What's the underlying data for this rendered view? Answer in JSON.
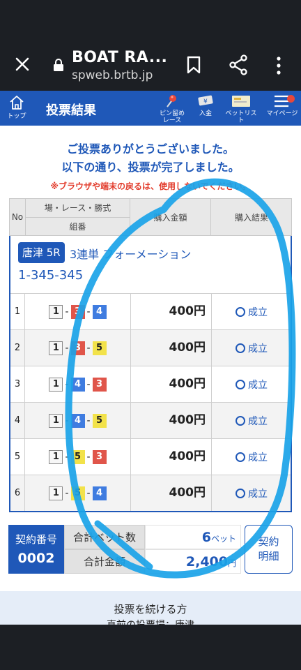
{
  "browser": {
    "title": "BOAT RA...",
    "url": "spweb.brtb.jp"
  },
  "header": {
    "home_label": "トップ",
    "page_title": "投票結果",
    "pin_label_1": "ピン留め",
    "pin_label_2": "レース",
    "deposit_label": "入金",
    "betlist_label": "ベットリスト",
    "mypage_label": "マイページ"
  },
  "messages": {
    "line1": "ご投票ありがとうございました。",
    "line2": "以下の通り、投票が完了しました。",
    "warning": "※ブラウザや端末の戻るは、使用しないでください。"
  },
  "table": {
    "col_no": "No",
    "col_combo_1": "場・レース・勝式",
    "col_combo_2": "組番",
    "col_amount": "購入金額",
    "col_result": "購入結果",
    "race": {
      "venue_race": "唐津 5R",
      "bet_type": "3連単 フォーメーション",
      "combination": "1-345-345"
    },
    "rows": [
      {
        "no": "1",
        "b1": "1",
        "b2": "3",
        "b3": "4",
        "amount": "400円",
        "result": "成立"
      },
      {
        "no": "2",
        "b1": "1",
        "b2": "3",
        "b3": "5",
        "amount": "400円",
        "result": "成立"
      },
      {
        "no": "3",
        "b1": "1",
        "b2": "4",
        "b3": "3",
        "amount": "400円",
        "result": "成立"
      },
      {
        "no": "4",
        "b1": "1",
        "b2": "4",
        "b3": "5",
        "amount": "400円",
        "result": "成立"
      },
      {
        "no": "5",
        "b1": "1",
        "b2": "5",
        "b3": "3",
        "amount": "400円",
        "result": "成立"
      },
      {
        "no": "6",
        "b1": "1",
        "b2": "5",
        "b3": "4",
        "amount": "400円",
        "result": "成立"
      }
    ]
  },
  "summary": {
    "contract_label": "契約番号",
    "contract_no": "0002",
    "total_bets_label": "合計ベット数",
    "total_bets_value": "6",
    "total_bets_unit": "ベット",
    "total_amount_label": "合計金額",
    "total_amount_value": "2,400",
    "total_amount_unit": "円",
    "detail_button_1": "契約",
    "detail_button_2": "明細"
  },
  "continue": {
    "title": "投票を続ける方",
    "subtitle": "直前の投票場：唐津"
  },
  "colors": {
    "primary": "#1f58b8",
    "warning": "#e23b2b",
    "boat3": "#e0554a",
    "boat4": "#3f7ce0",
    "boat5": "#f2e24a",
    "scribble": "#1aa3e8"
  }
}
